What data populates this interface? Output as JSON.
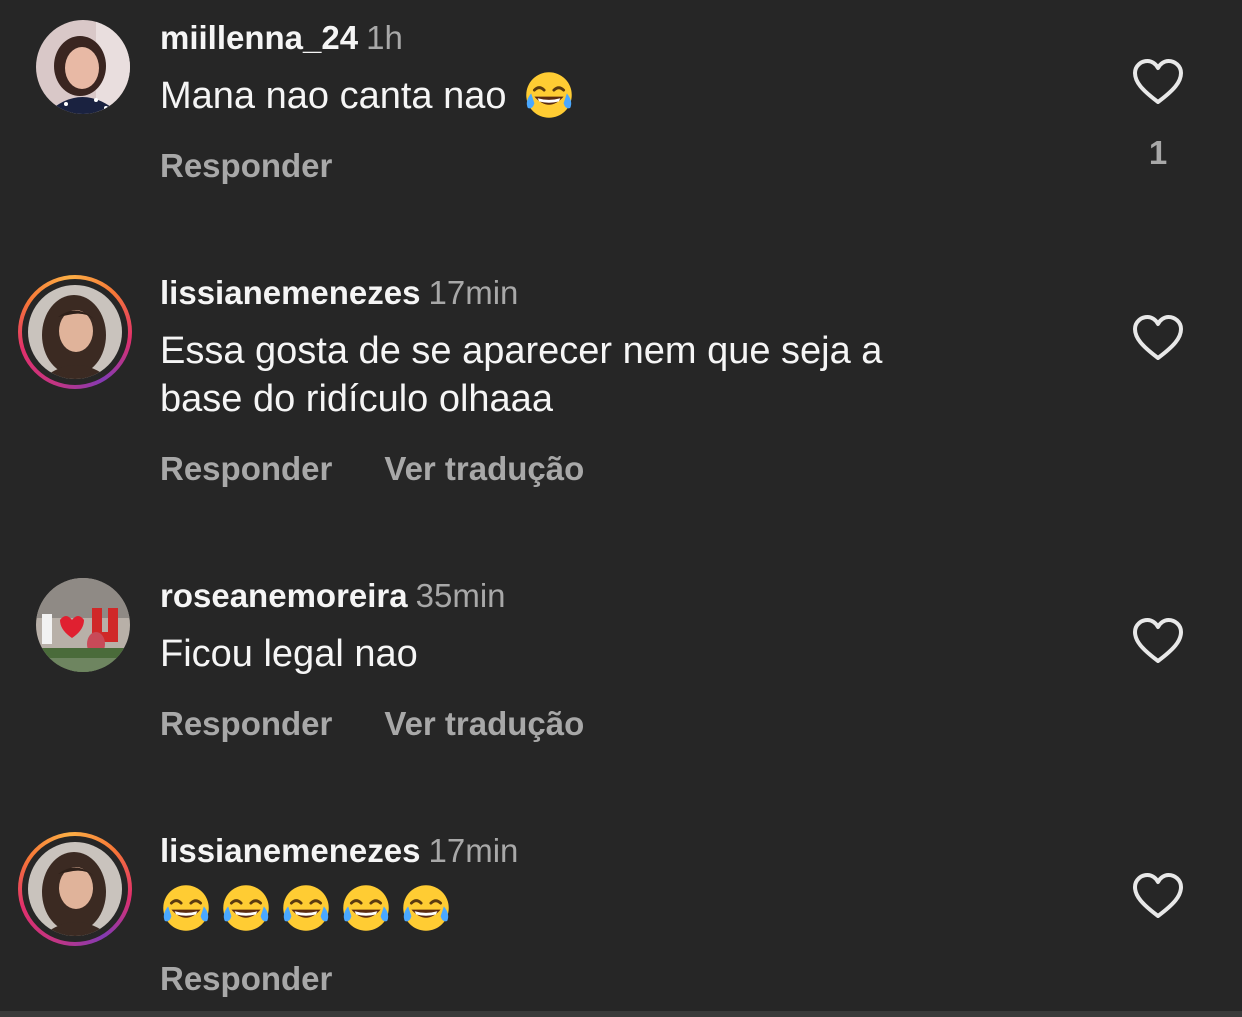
{
  "comments": [
    {
      "username": "miillenna_24",
      "time": "1h",
      "text": "Mana nao canta nao",
      "emoji": "face-with-tears-of-joy",
      "actions": [
        "Responder"
      ],
      "like_count": "1",
      "has_story_ring": false
    },
    {
      "username": "lissianemenezes",
      "time": "17min",
      "text_line1": "Essa gosta de se aparecer nem que seja a",
      "text_line2": "base do ridículo olhaaa",
      "actions": [
        "Responder",
        "Ver tradução"
      ],
      "has_story_ring": true
    },
    {
      "username": "roseanemoreira",
      "time": "35min",
      "text": "Ficou legal nao",
      "actions": [
        "Responder",
        "Ver tradução"
      ],
      "has_story_ring": false
    },
    {
      "username": "lissianemenezes",
      "time": "17min",
      "emoji_count": 5,
      "emoji": "face-with-tears-of-joy",
      "actions": [
        "Responder"
      ],
      "has_story_ring": true
    }
  ],
  "colors": {
    "background": "#262626",
    "primary_text": "#f5f5f5",
    "secondary_text": "#a8a8a8"
  },
  "icons": {
    "like": "heart-outline-icon"
  }
}
